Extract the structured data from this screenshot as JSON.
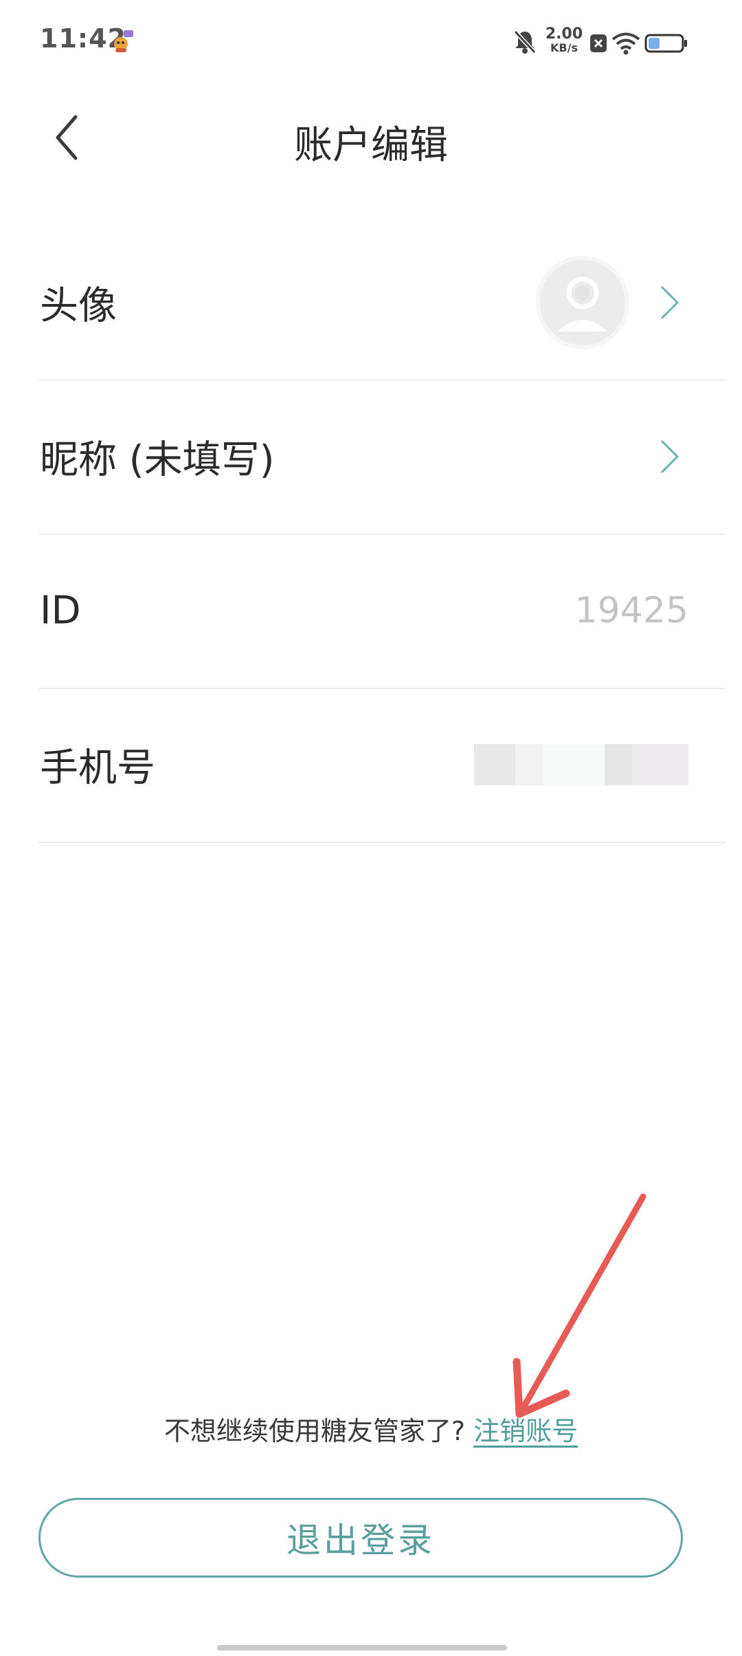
{
  "status_bar": {
    "time": "11:42",
    "net_speed_value": "2.00",
    "net_speed_unit": "KB/s",
    "battery_level": 0.35
  },
  "header": {
    "title": "账户编辑",
    "back_icon": "chevron-left-icon"
  },
  "rows": {
    "avatar": {
      "label": "头像",
      "chevron_icon": "chevron-right-icon"
    },
    "nickname": {
      "label": "昵称 (未填写)",
      "chevron_icon": "chevron-right-icon"
    },
    "id": {
      "label": "ID",
      "value": "19425"
    },
    "phone": {
      "label": "手机号"
    }
  },
  "footer": {
    "deactivate_prompt": "不想继续使用糖友管家了?",
    "deactivate_link": "注销账号",
    "logout_label": "退出登录"
  },
  "colors": {
    "accent": "#5fa6a4",
    "annotation_arrow": "#e85a56",
    "divider": "#ececec"
  }
}
